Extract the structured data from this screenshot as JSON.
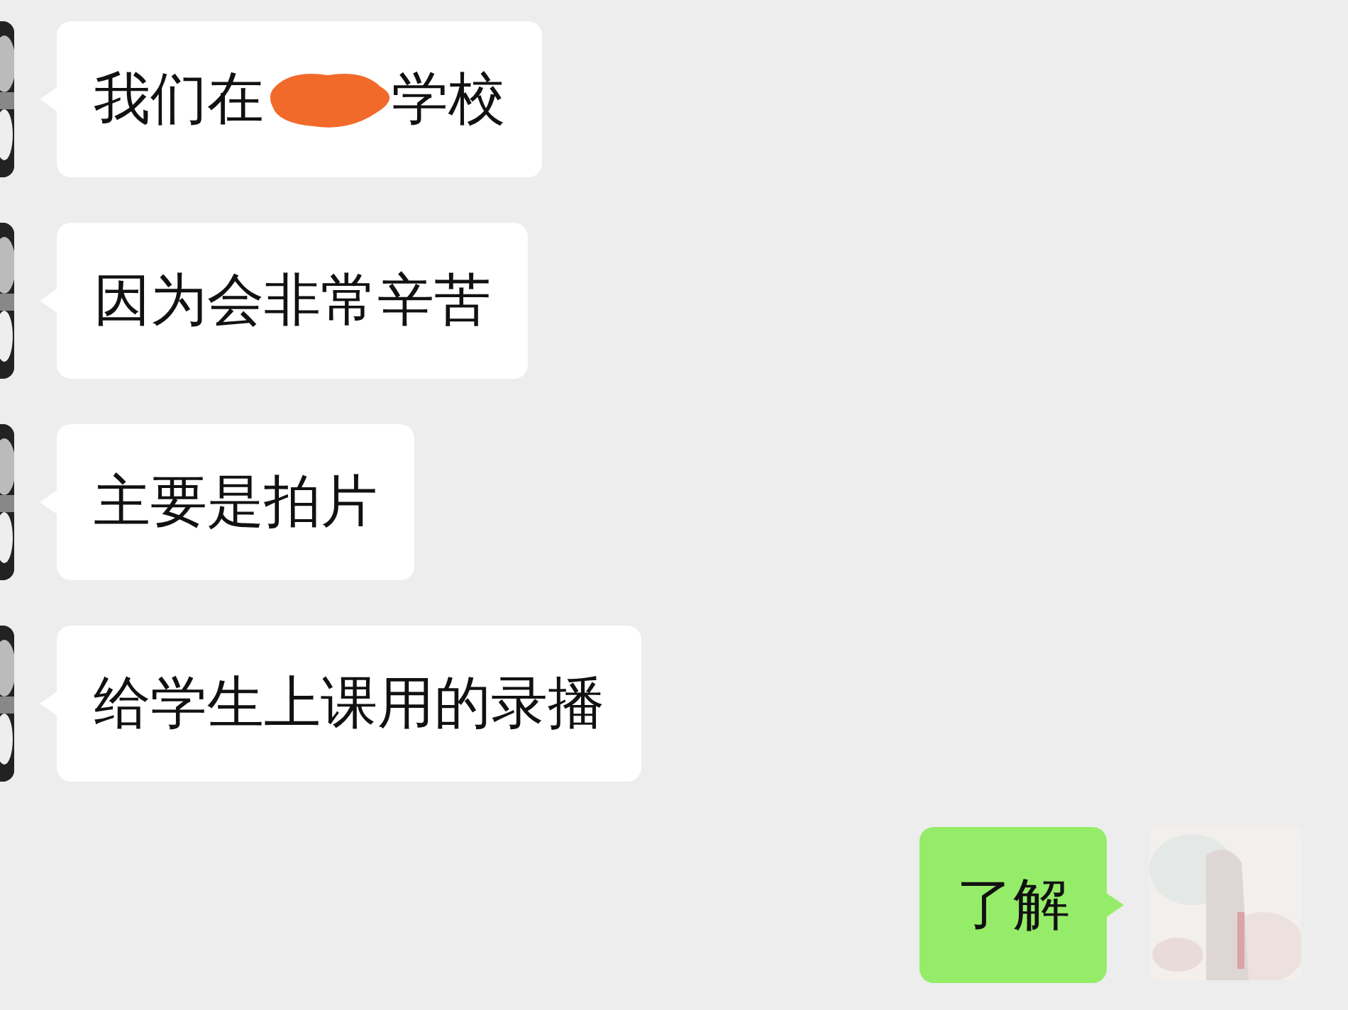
{
  "messages": [
    {
      "kind": "received",
      "parts": [
        {
          "kind": "text",
          "text": "我们在"
        },
        {
          "kind": "redaction"
        },
        {
          "kind": "text",
          "text": "学校"
        }
      ]
    },
    {
      "kind": "received",
      "parts": [
        {
          "kind": "text",
          "text": "因为会非常辛苦"
        }
      ]
    },
    {
      "kind": "received",
      "parts": [
        {
          "kind": "text",
          "text": "主要是拍片"
        }
      ]
    },
    {
      "kind": "received",
      "parts": [
        {
          "kind": "text",
          "text": "给学生上课用的录播"
        }
      ]
    },
    {
      "kind": "sent",
      "parts": [
        {
          "kind": "text",
          "text": "了解"
        }
      ]
    }
  ]
}
